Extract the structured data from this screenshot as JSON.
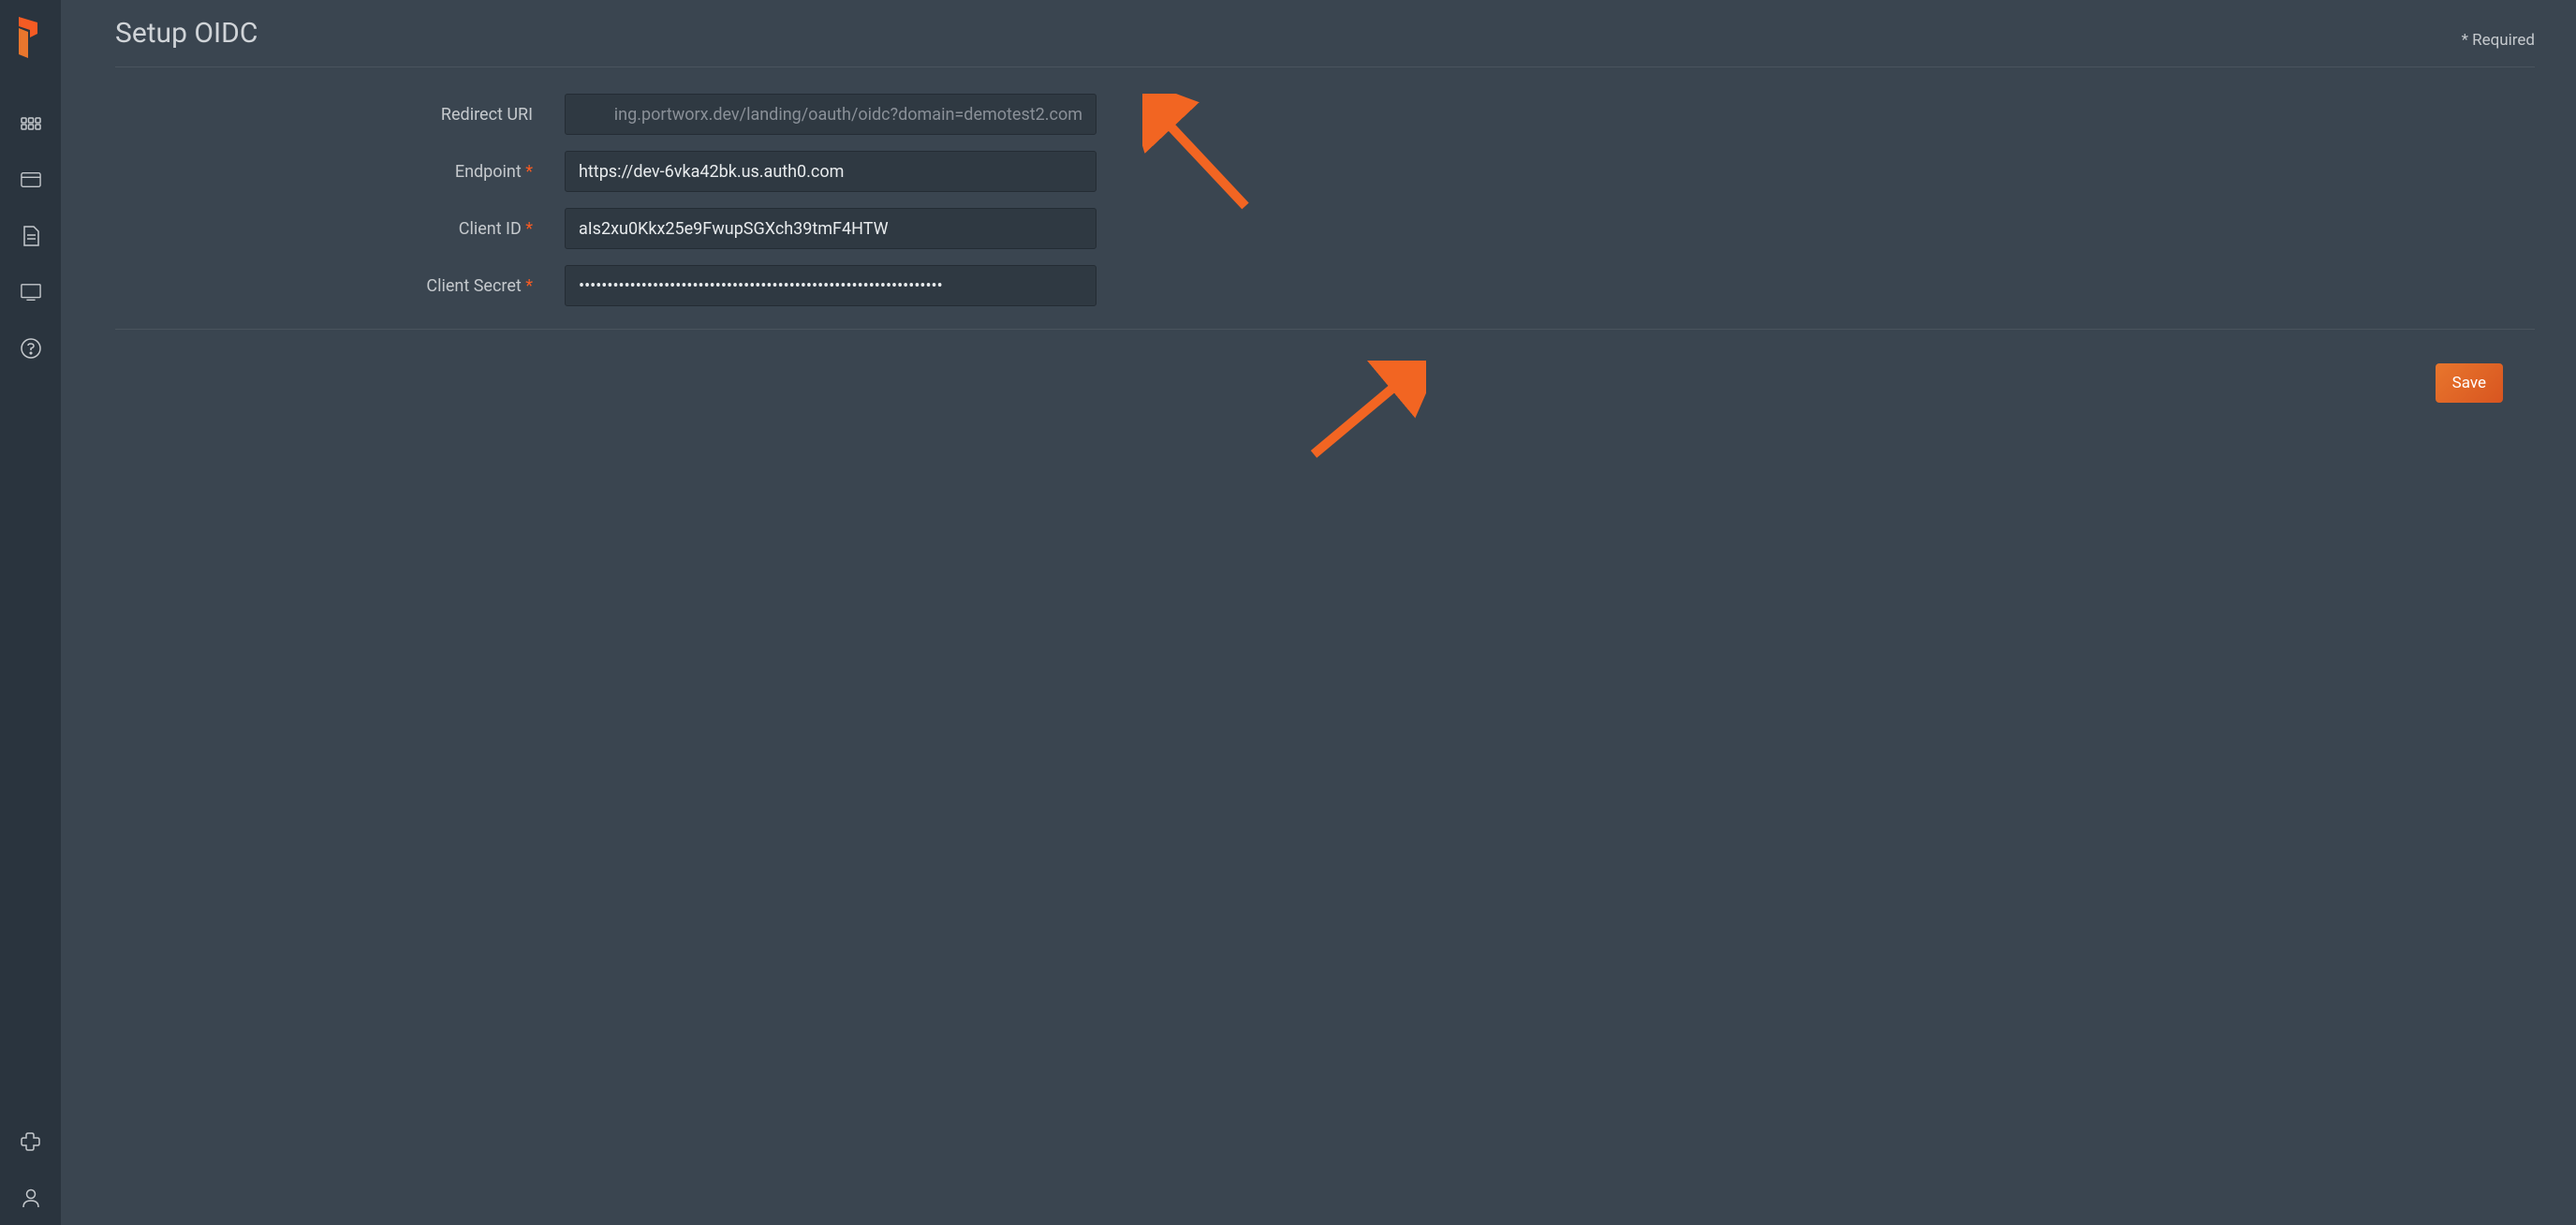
{
  "header": {
    "title": "Setup OIDC",
    "required_note": "* Required"
  },
  "form": {
    "redirect_uri": {
      "label": "Redirect URI",
      "value": "ing.portworx.dev/landing/oauth/oidc?domain=demotest2.com"
    },
    "endpoint": {
      "label": "Endpoint",
      "value": "https://dev-6vka42bk.us.auth0.com"
    },
    "client_id": {
      "label": "Client ID",
      "value": "aIs2xu0Kkx25e9FwupSGXch39tmF4HTW"
    },
    "client_secret": {
      "label": "Client Secret",
      "value": "••••••••••••••••••••••••••••••••••••••••••••••••••••••••••••••••"
    }
  },
  "buttons": {
    "save": "Save"
  }
}
